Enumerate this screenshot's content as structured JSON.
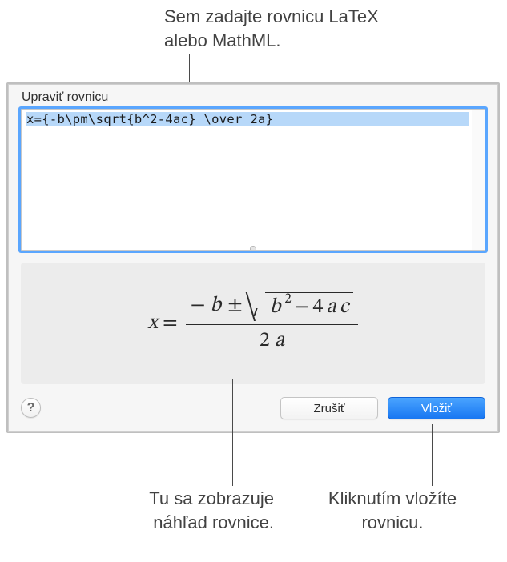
{
  "callouts": {
    "top": "Sem zadajte rovnicu LaTeX\nalebo MathML.",
    "bottom_left": "Tu sa zobrazuje\nnáhľad rovnice.",
    "bottom_right": "Kliknutím vložíte\nrovnicu."
  },
  "dialog": {
    "title": "Upraviť rovnicu",
    "input_value": "x={-b\\pm\\sqrt{b^2-4ac} \\over 2a}",
    "help_label": "?",
    "cancel_label": "Zrušiť",
    "insert_label": "Vložiť"
  },
  "preview": {
    "lhs_var": "x",
    "equals": "=",
    "minus": "−",
    "b": "b",
    "pm": "±",
    "sq_b": "b",
    "sq_b_exp": "2",
    "four": "4",
    "a": "a",
    "c": "c",
    "two": "2",
    "den_a": "a"
  }
}
